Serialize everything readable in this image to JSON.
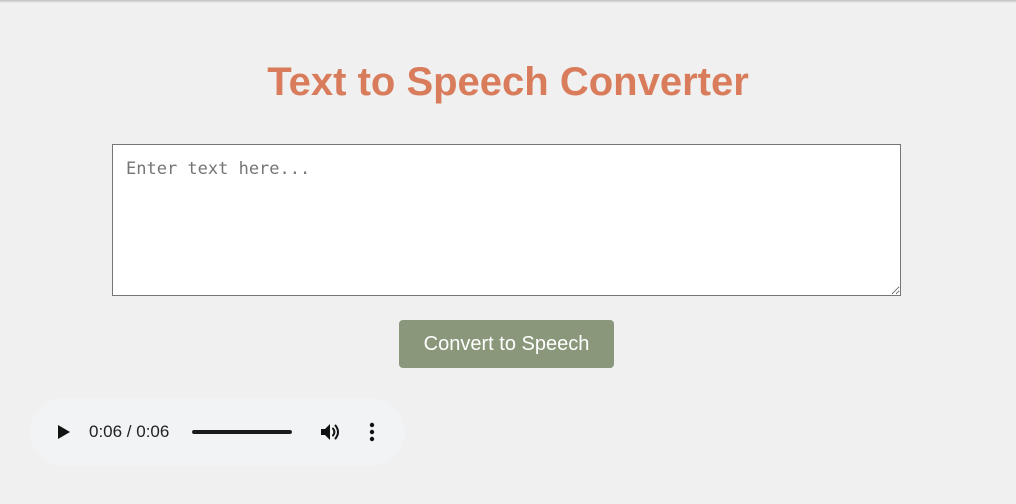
{
  "page": {
    "title": "Text to Speech Converter"
  },
  "text_input": {
    "placeholder": "Enter text here...",
    "value": ""
  },
  "convert_button": {
    "label": "Convert to Speech"
  },
  "audio_player": {
    "time_display": "0:06 / 0:06",
    "progress_fraction": 1.0,
    "play_icon": "play-icon",
    "volume_icon": "volume-icon",
    "more_icon": "more-vertical-icon"
  },
  "colors": {
    "title": "#d97c5c",
    "button": "#8a977b",
    "background": "#f0f0f0",
    "player_background": "#f1f3f4"
  }
}
